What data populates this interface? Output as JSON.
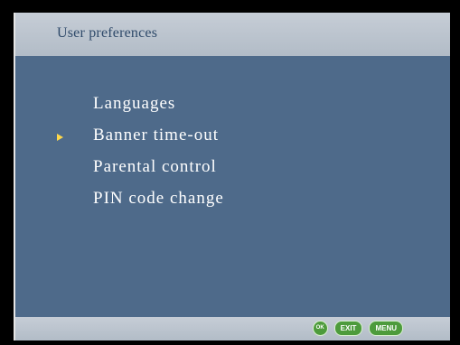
{
  "header": {
    "title": "User preferences"
  },
  "menu": {
    "items": [
      {
        "label": "Languages",
        "selected": false
      },
      {
        "label": "Banner time-out",
        "selected": true
      },
      {
        "label": "Parental control",
        "selected": false
      },
      {
        "label": "PIN code change",
        "selected": false
      }
    ]
  },
  "footer": {
    "keys": [
      {
        "label": "OK"
      },
      {
        "label": "EXIT"
      },
      {
        "label": "MENU"
      }
    ]
  },
  "colors": {
    "panel_background": "#4e6a8a",
    "header_bar": "#c6cdd6",
    "title_text": "#2f4a6a",
    "pointer": "#ffd84a",
    "key_button": "#4d9b3c"
  },
  "icons": {
    "selection_pointer": "triangle-right-icon"
  }
}
